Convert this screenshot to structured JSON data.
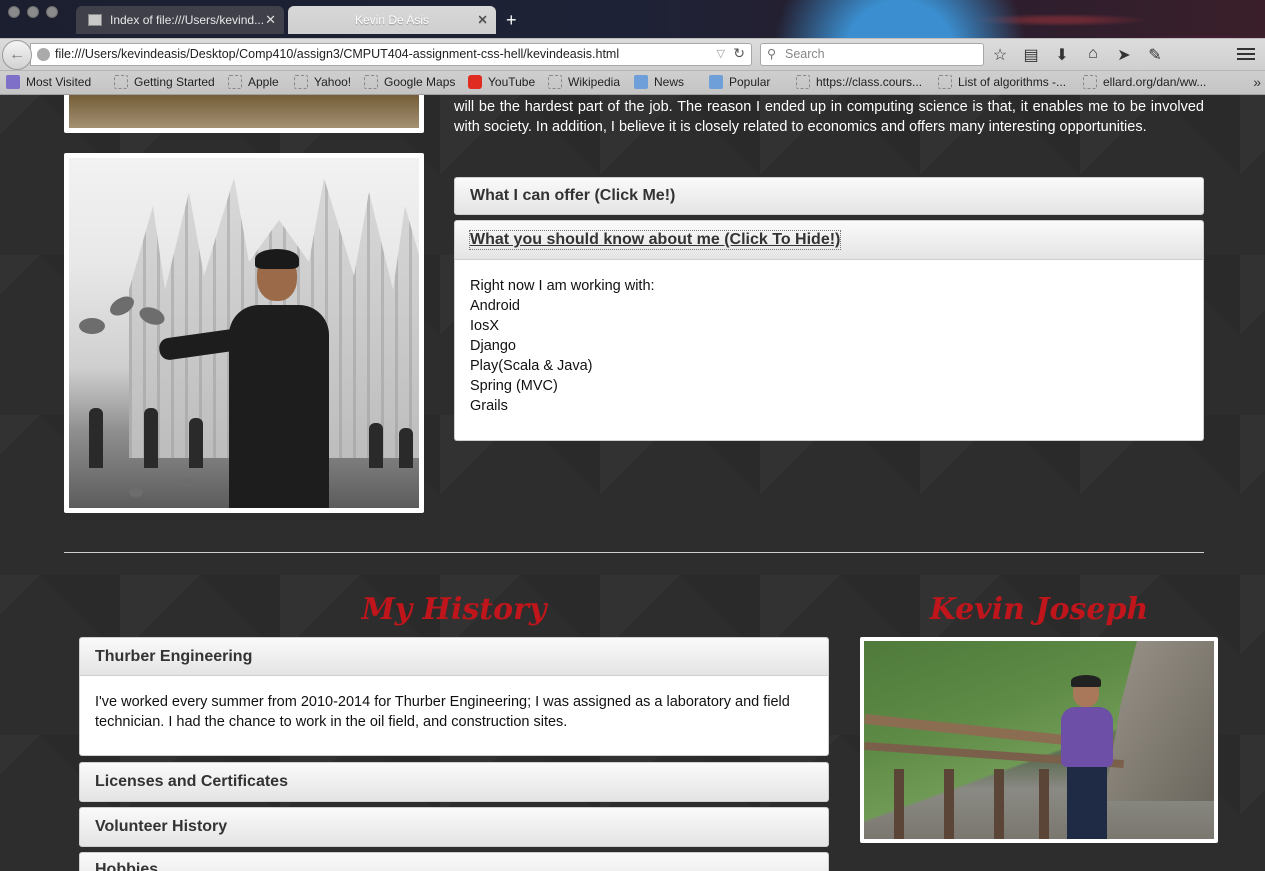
{
  "browser": {
    "tabs": [
      {
        "title": "Index of file:///Users/kevind...",
        "active": false
      },
      {
        "title": "Kevin De Asis",
        "active": true
      }
    ],
    "url": "file:///Users/kevindeasis/Desktop/Comp410/assign3/CMPUT404-assignment-css-hell/kevindeasis.html",
    "search_placeholder": "Search",
    "bookmarks": [
      {
        "label": "Most Visited",
        "icon": "most-visited-icon"
      },
      {
        "label": "Getting Started",
        "icon": "page-icon"
      },
      {
        "label": "Apple",
        "icon": "page-icon"
      },
      {
        "label": "Yahoo!",
        "icon": "page-icon"
      },
      {
        "label": "Google Maps",
        "icon": "page-icon"
      },
      {
        "label": "YouTube",
        "icon": "youtube-icon"
      },
      {
        "label": "Wikipedia",
        "icon": "page-icon"
      },
      {
        "label": "News",
        "icon": "folder-icon"
      },
      {
        "label": "Popular",
        "icon": "folder-icon"
      },
      {
        "label": "https://class.cours...",
        "icon": "page-icon"
      },
      {
        "label": "List of algorithms -...",
        "icon": "page-icon"
      },
      {
        "label": "ellard.org/dan/ww...",
        "icon": "page-icon"
      }
    ]
  },
  "about": {
    "intro_text": "interesting ideas, which I know will be sustainable. My goal is to find a job or co-found a startup wherein retirement will be the hardest part of the job. The reason I ended up in computing science is that, it enables me to be involved with society. In addition, I believe it is closely related to economics and offers many interesting opportunities.",
    "offer_label": "What I can offer (Click Me!)",
    "know_label": "What you should know about me (Click To Hide!)",
    "know_intro": "Right now I am working with:",
    "know_items": [
      "Android",
      "IosX",
      "Django",
      "Play(Scala & Java)",
      "Spring (MVC)",
      "Grails"
    ]
  },
  "history": {
    "title": "My History",
    "thurber_label": "Thurber Engineering",
    "thurber_text": "I've worked every summer from 2010-2014 for Thurber Engineering; I was assigned as a laboratory and field technician. I had the chance to work in the oil field, and construction sites.",
    "licenses_label": "Licenses and Certificates",
    "volunteer_label": "Volunteer History",
    "hobbies_label": "Hobbies"
  },
  "profile": {
    "name": "Kevin Joseph"
  },
  "colors": {
    "accent_red": "#c0161b",
    "page_bg": "#2d2d2d"
  }
}
